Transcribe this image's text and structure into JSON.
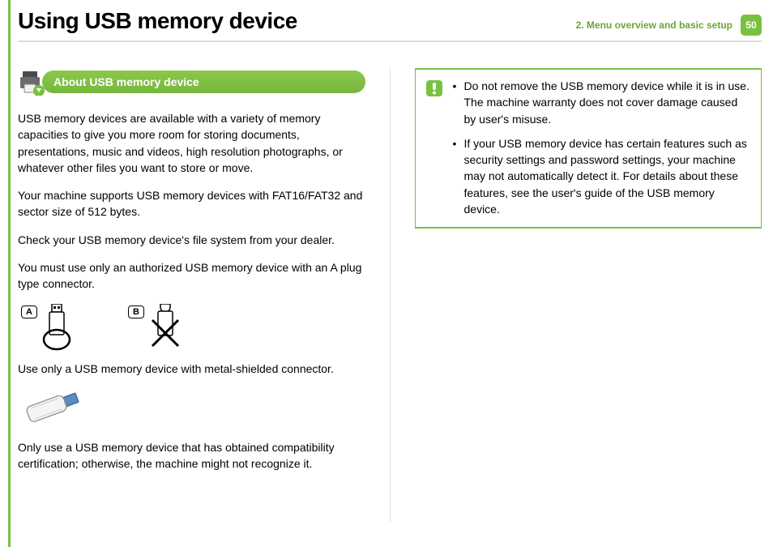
{
  "header": {
    "title": "Using USB memory device",
    "breadcrumb": "2.  Menu overview and basic setup",
    "page_number": "50"
  },
  "section": {
    "heading": "About USB memory device"
  },
  "left_col": {
    "p1": "USB memory devices are available with a variety of memory capacities to give you more room for storing documents, presentations, music and videos, high resolution photographs, or whatever other files you want to store or move.",
    "p2": "Your machine supports USB memory devices with FAT16/FAT32 and sector size of 512 bytes.",
    "p3": "Check your USB memory device's file system from your dealer.",
    "p4": "You must use only an authorized USB memory device with an A plug type connector.",
    "label_a": "A",
    "label_b": "B",
    "p5": "Use only a USB memory device with metal-shielded connector.",
    "p6": "Only use a USB memory device that has obtained compatibility certification; otherwise, the machine might not recognize it."
  },
  "tips": {
    "item1": "Do not remove the USB memory device while it is in use. The machine warranty does not cover damage caused by user's misuse.",
    "item2": "If your USB memory device has certain features such as security settings and password settings, your machine may not automatically detect it. For details about these features, see the user's guide of the USB memory device."
  }
}
